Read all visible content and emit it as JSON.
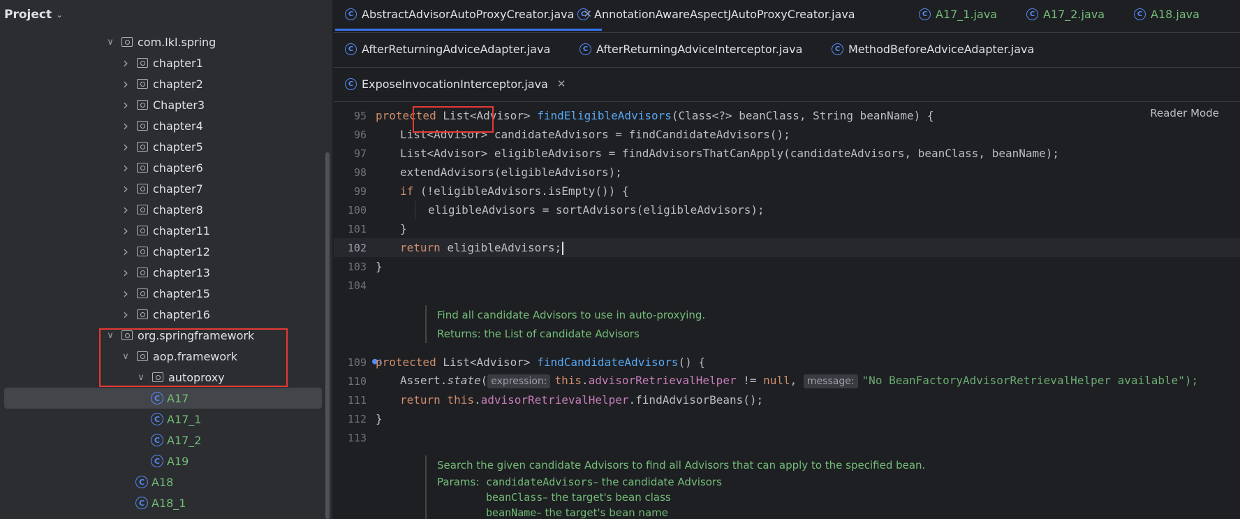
{
  "project": {
    "title": "Project",
    "tree": [
      {
        "label": "com.lkl.spring",
        "type": "package",
        "arrow": "down",
        "depth": 0
      },
      {
        "label": "chapter1",
        "type": "package",
        "arrow": "right",
        "depth": 1
      },
      {
        "label": "chapter2",
        "type": "package",
        "arrow": "right",
        "depth": 1
      },
      {
        "label": "Chapter3",
        "type": "package",
        "arrow": "right",
        "depth": 1
      },
      {
        "label": "chapter4",
        "type": "package",
        "arrow": "right",
        "depth": 1
      },
      {
        "label": "chapter5",
        "type": "package",
        "arrow": "right",
        "depth": 1
      },
      {
        "label": "chapter6",
        "type": "package",
        "arrow": "right",
        "depth": 1
      },
      {
        "label": "chapter7",
        "type": "package",
        "arrow": "right",
        "depth": 1
      },
      {
        "label": "chapter8",
        "type": "package",
        "arrow": "right",
        "depth": 1
      },
      {
        "label": "chapter11",
        "type": "package",
        "arrow": "right",
        "depth": 1
      },
      {
        "label": "chapter12",
        "type": "package",
        "arrow": "right",
        "depth": 1
      },
      {
        "label": "chapter13",
        "type": "package",
        "arrow": "right",
        "depth": 1
      },
      {
        "label": "chapter15",
        "type": "package",
        "arrow": "right",
        "depth": 1
      },
      {
        "label": "chapter16",
        "type": "package",
        "arrow": "right",
        "depth": 1
      },
      {
        "label": "org.springframework",
        "type": "package",
        "arrow": "down",
        "depth": 0
      },
      {
        "label": "aop.framework",
        "type": "package",
        "arrow": "down",
        "depth": 1
      },
      {
        "label": "autoproxy",
        "type": "package",
        "arrow": "down",
        "depth": 2
      },
      {
        "label": "A17",
        "type": "class",
        "arrow": "none",
        "depth": 3,
        "selected": true
      },
      {
        "label": "A17_1",
        "type": "class",
        "arrow": "none",
        "depth": 3
      },
      {
        "label": "A17_2",
        "type": "class",
        "arrow": "none",
        "depth": 3
      },
      {
        "label": "A19",
        "type": "class",
        "arrow": "none",
        "depth": 3
      },
      {
        "label": "A18",
        "type": "class",
        "arrow": "none",
        "depth": 2
      },
      {
        "label": "A18_1",
        "type": "class",
        "arrow": "none",
        "depth": 2
      }
    ]
  },
  "tabs": [
    {
      "label": "AbstractAdvisorAutoProxyCreator.java",
      "active": true,
      "closable": true,
      "green": false
    },
    {
      "label": "AnnotationAwareAspectJAutoProxyCreator.java",
      "green": false
    },
    {
      "label": "A17_1.java",
      "green": true
    },
    {
      "label": "A17_2.java",
      "green": true
    },
    {
      "label": "A18.java",
      "green": true
    },
    {
      "label": "AfterReturningAdviceAdapter.java",
      "green": false
    },
    {
      "label": "AfterReturningAdviceInterceptor.java",
      "green": false
    },
    {
      "label": "MethodBeforeAdviceAdapter.java",
      "green": false
    },
    {
      "label": "ExposeInvocationInterceptor.java",
      "closable": true,
      "green": false
    }
  ],
  "editor": {
    "reader_mode": "Reader Mode",
    "line_numbers": [
      "95",
      "96",
      "97",
      "98",
      "99",
      "100",
      "101",
      "102",
      "103",
      "104",
      "109",
      "110",
      "111",
      "112",
      "113"
    ],
    "code": {
      "l95_kw": "protected",
      "l95_a": " List<Advisor> ",
      "l95_fn": "findEligibleAdvisors",
      "l95_b": "(Class<?> beanClass, String beanName) {",
      "l96": "List<Advisor> candidateAdvisors = findCandidateAdvisors();",
      "l97": "List<Advisor> eligibleAdvisors = findAdvisorsThatCanApply(candidateAdvisors, beanClass, beanName);",
      "l98": "extendAdvisors(eligibleAdvisors);",
      "l99_kw": "if",
      "l99": " (!eligibleAdvisors.isEmpty()) {",
      "l100": "eligibleAdvisors = sortAdvisors(eligibleAdvisors);",
      "l101": "}",
      "l102_kw": "return",
      "l102": " eligibleAdvisors;",
      "l103": "}",
      "l109_kw": "protected",
      "l109_a": " List<Advisor> ",
      "l109_fn": "findCandidateAdvisors",
      "l109_b": "() {",
      "l110_a": "Assert.",
      "l110_m": "state",
      "l110_b": "(",
      "l110_hint1": "expression:",
      "l110_this": "this",
      "l110_dot": ".",
      "l110_fld": "advisorRetrievalHelper",
      "l110_c": " != ",
      "l110_null": "null",
      "l110_comma": ", ",
      "l110_hint2": "message:",
      "l110_str": "\"No BeanFactoryAdvisorRetrievalHelper available\");",
      "l111_kw": "return",
      "l111_this": " this",
      "l111_dot": ".",
      "l111_fld": "advisorRetrievalHelper",
      "l111_b": ".findAdvisorBeans();",
      "l112": "}"
    },
    "doc1": {
      "summary": "Find all candidate Advisors to use in auto-proxying.",
      "returns": "Returns: the List of candidate Advisors"
    },
    "doc2": {
      "summary": "Search the given candidate Advisors to find all Advisors that can apply to the specified bean.",
      "params_label": "Params:",
      "params": [
        {
          "name": "candidateAdvisors",
          "desc": " – the candidate Advisors"
        },
        {
          "name": "beanClass",
          "desc": " – the target's bean class"
        },
        {
          "name": "beanName",
          "desc": " – the target's bean name"
        }
      ]
    }
  }
}
